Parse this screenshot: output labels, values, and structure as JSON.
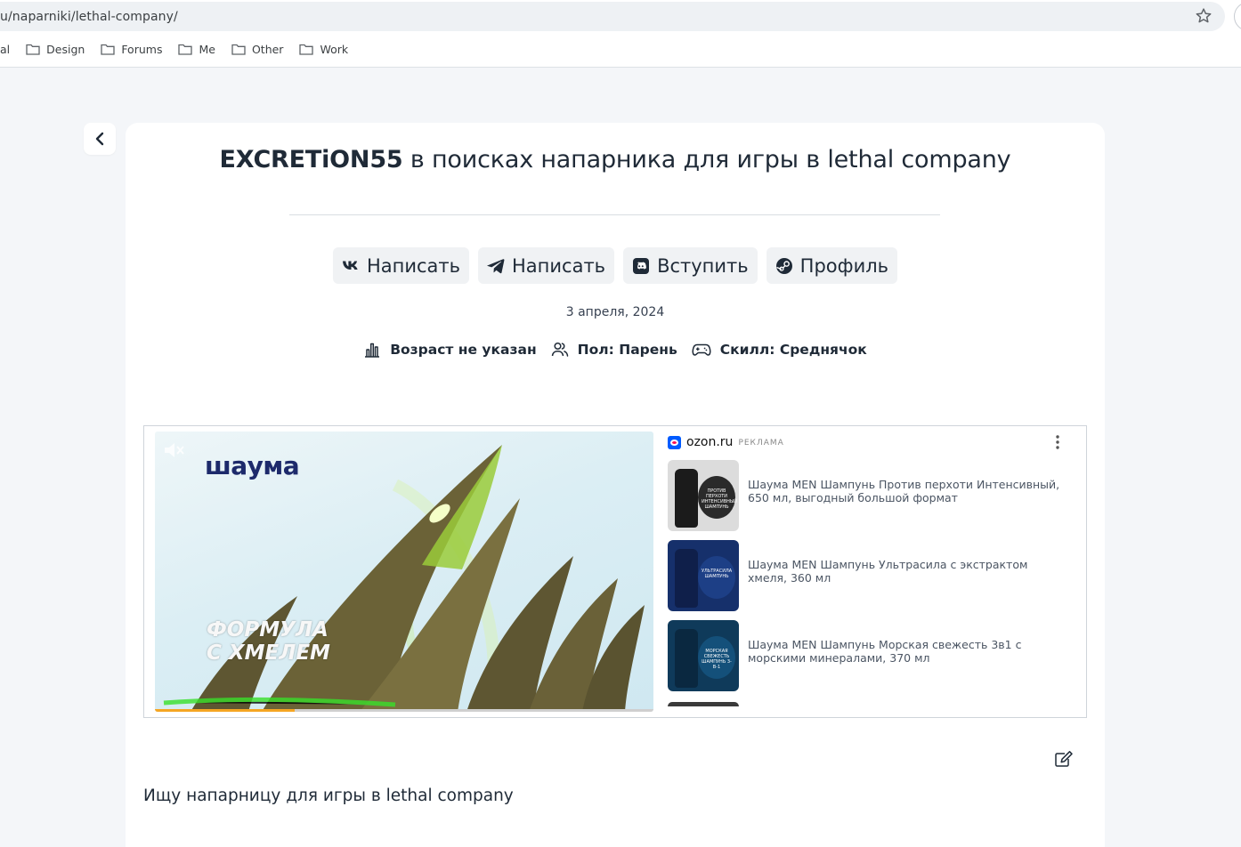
{
  "browser": {
    "url": "u/naparniki/lethal-company/",
    "bookmarks": [
      "al",
      "Design",
      "Forums",
      "Me",
      "Other",
      "Work"
    ]
  },
  "post": {
    "nickname": "EXCRETiON55",
    "title_rest": " в поисках напарника для игры в lethal company",
    "buttons": [
      {
        "label": "Написать",
        "icon": "vk-icon"
      },
      {
        "label": "Написать",
        "icon": "telegram-icon"
      },
      {
        "label": "Вступить",
        "icon": "discord-icon"
      },
      {
        "label": "Профиль",
        "icon": "steam-icon"
      }
    ],
    "date": "3 апреля, 2024",
    "meta": {
      "age": "Возраст не указан",
      "gender": "Пол: Парень",
      "skill": "Скилл: Среднячок"
    },
    "description": "Ищу напарницу для игры в lethal company"
  },
  "ad": {
    "brand": "шаума",
    "slogan_line1": "ФОРМУЛА",
    "slogan_line2": "С ХМЕЛЕМ",
    "advertiser": "ozon.ru",
    "ad_label": "РЕКЛАМА",
    "video_progress": 0.28,
    "products": [
      {
        "title": "Шаума MEN Шампунь Против перхоти Интенсивный, 650 мл, выгодный большой формат",
        "jar_text": "ПРОТИВ ПЕРХОТИ ИНТЕНСИВНЫЙ ШАМПУНЬ"
      },
      {
        "title": "Шаума MEN Шампунь Ультрасила с экстрактом хмеля, 360 мл",
        "jar_text": "УЛЬТРАСИЛА ШАМПУНЬ"
      },
      {
        "title": "Шаума MEN Шампунь Морская свежесть 3в1 с морскими минералами, 370 мл",
        "jar_text": "МОРСКАЯ СВЕЖЕСТЬ ШАМПУНЬ 3-В-1"
      }
    ]
  },
  "colors": {
    "page_bg": "#f4f6f9",
    "card_bg": "#ffffff",
    "button_bg": "#f0f2f4",
    "text": "#1f2a37",
    "ozon_blue": "#005bff",
    "progress": "#f5a623"
  }
}
